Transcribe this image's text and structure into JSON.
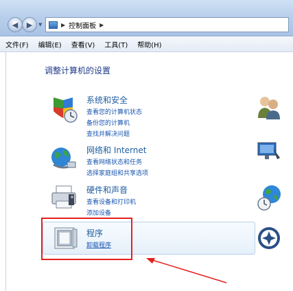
{
  "address_bar": {
    "path": [
      "控制面板"
    ]
  },
  "menu": [
    {
      "label": "文件(F)"
    },
    {
      "label": "编辑(E)"
    },
    {
      "label": "查看(V)"
    },
    {
      "label": "工具(T)"
    },
    {
      "label": "帮助(H)"
    }
  ],
  "page_title": "调整计算机的设置",
  "categories": [
    {
      "title": "系统和安全",
      "links": [
        "查看您的计算机状态",
        "备份您的计算机",
        "查找并解决问题"
      ],
      "icon": "shield-icon"
    },
    {
      "title": "网络和 Internet",
      "links": [
        "查看网络状态和任务",
        "选择家庭组和共享选项"
      ],
      "icon": "network-globe-icon"
    },
    {
      "title": "硬件和声音",
      "links": [
        "查看设备和打印机",
        "添加设备"
      ],
      "icon": "printer-icon"
    },
    {
      "title": "程序",
      "links": [
        "卸载程序"
      ],
      "icon": "programs-icon"
    }
  ],
  "right_icons": [
    "user-accounts-icon",
    "appearance-icon",
    "clock-globe-icon",
    "ease-of-access-icon"
  ],
  "annotation": {
    "highlight_color": "#e5201d",
    "arrow_color": "#e5201d"
  }
}
